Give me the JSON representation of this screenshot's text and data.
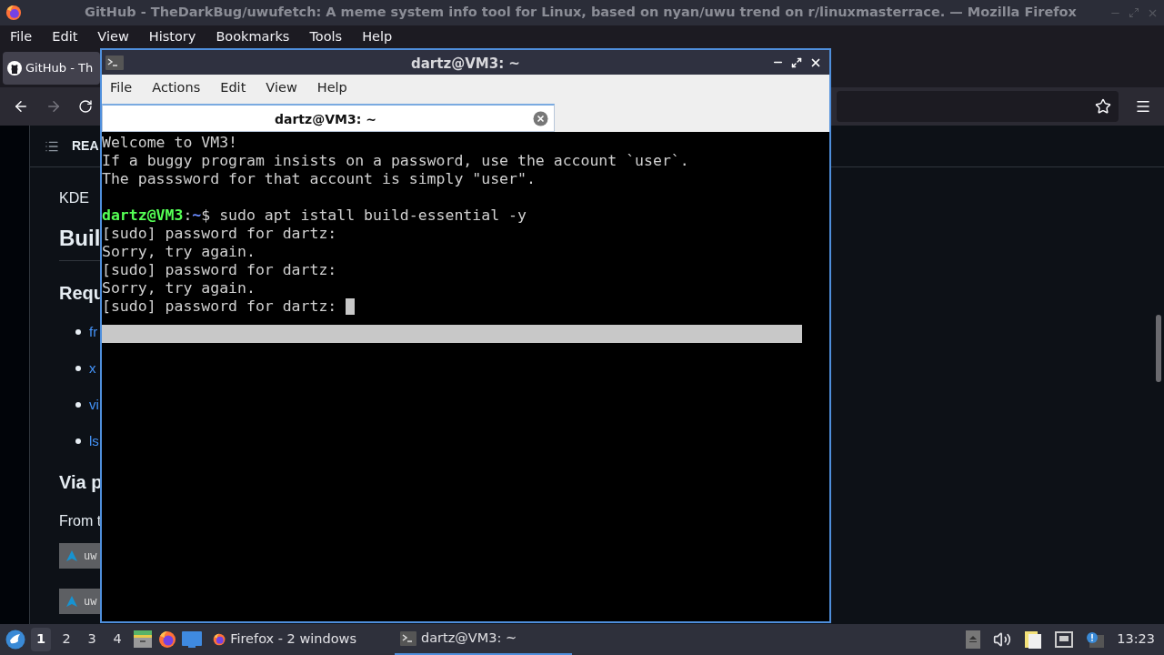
{
  "firefox": {
    "title": "GitHub - TheDarkBug/uwufetch: A meme system info tool for Linux, based on nyan/uwu trend on r/linuxmasterrace. — Mozilla Firefox",
    "menus": [
      "File",
      "Edit",
      "View",
      "History",
      "Bookmarks",
      "Tools",
      "Help"
    ],
    "tab": {
      "label": "GitHub - Th"
    },
    "page": {
      "header": "REA",
      "intro": "KDE",
      "heading": "Buil",
      "subheading": "Requ",
      "links": [
        "fr",
        "x",
        "vi",
        "ls"
      ],
      "heading2": "Via p",
      "paragraph": "From t",
      "code_blocks": [
        "uw",
        "uw"
      ]
    }
  },
  "terminal": {
    "title": "dartz@VM3: ~",
    "menus": [
      "File",
      "Actions",
      "Edit",
      "View",
      "Help"
    ],
    "tab": {
      "label": "dartz@VM3: ~"
    },
    "lines": [
      {
        "kind": "text",
        "text": "Welcome to VM3!"
      },
      {
        "kind": "text",
        "text": "If a buggy program insists on a password, use the account `user`."
      },
      {
        "kind": "text",
        "text": "The passsword for that account is simply \"user\"."
      },
      {
        "kind": "blank"
      },
      {
        "kind": "prompt",
        "user_host": "dartz@VM3",
        "sep": ":",
        "path": "~",
        "command": "$ sudo apt istall build-essential -y"
      },
      {
        "kind": "text",
        "text": "[sudo] password for dartz:"
      },
      {
        "kind": "text",
        "text": "Sorry, try again."
      },
      {
        "kind": "text",
        "text": "[sudo] password for dartz:"
      },
      {
        "kind": "text",
        "text": "Sorry, try again."
      },
      {
        "kind": "text",
        "text": "[sudo] password for dartz: ",
        "cursor": true
      }
    ]
  },
  "taskbar": {
    "desktops": [
      {
        "label": "1",
        "selected": true
      },
      {
        "label": "2",
        "selected": false
      },
      {
        "label": "3",
        "selected": false
      },
      {
        "label": "4",
        "selected": false
      }
    ],
    "tasks": [
      {
        "label": "Firefox - 2 windows",
        "kind": "firefox",
        "selected": false
      },
      {
        "label": "dartz@VM3: ~",
        "kind": "terminal",
        "selected": true
      }
    ],
    "clock": "13:23"
  }
}
